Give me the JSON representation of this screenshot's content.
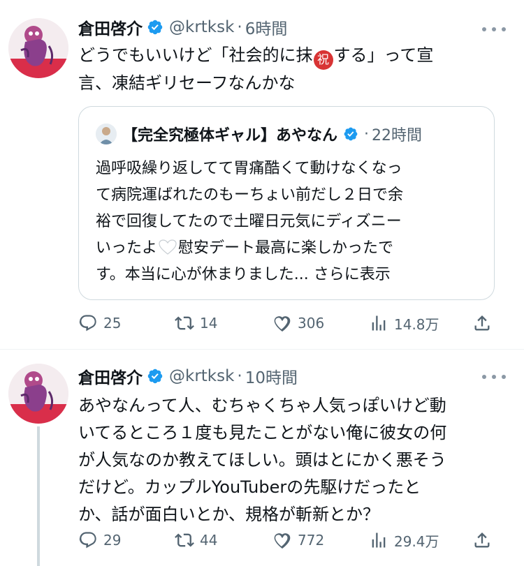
{
  "tweet1": {
    "author": {
      "name": "倉田啓介",
      "handle": "@krtksk",
      "time": "6時間"
    },
    "text_lines": [
      "どうでもいいけど「社会的に抹",
      "する」って宣",
      "言、凍結ギリセーフなんかな"
    ],
    "inline_emoji_char": "祝",
    "quote": {
      "author": {
        "name": "【完全究極体ギャル】あやなん",
        "time": "22時間"
      },
      "text_lines": [
        "過呼吸繰り返してて胃痛酷くて動けなくなっ",
        "て病院運ばれたのもーちょい前だし２日で余",
        "裕で回復してたので土曜日元気にディズニー",
        "いったよ",
        "慰安デート最高に楽しかったで",
        "す。本当に心が休まりました..."
      ],
      "show_more": "さらに表示"
    },
    "stats": {
      "replies": "25",
      "retweets": "14",
      "likes": "306",
      "views": "14.8万"
    }
  },
  "tweet2": {
    "author": {
      "name": "倉田啓介",
      "handle": "@krtksk",
      "time": "10時間"
    },
    "text_lines": [
      "あやなんって人、むちゃくちゃ人気っぽいけど動",
      "いてるところ１度も見たことがない俺に彼女の何",
      "が人気なのか教えてほしい。頭はとにかく悪そう",
      "だけど。カップルYouTuberの先駆けだったと",
      "か、話が面白いとか、規格が斬新とか？"
    ],
    "stats": {
      "replies": "29",
      "retweets": "44",
      "likes": "772",
      "views": "29.4万"
    }
  },
  "ui": {
    "separator": "·"
  },
  "colors": {
    "verified": "#1d9bf0",
    "secondary_text": "#536471",
    "border": "#cfd9de",
    "emoji_red": "#d83434"
  },
  "icons": [
    "verified-badge-icon",
    "more-options-icon",
    "reply-icon",
    "retweet-icon",
    "like-icon",
    "views-icon",
    "share-icon",
    "white-heart-emoji-icon"
  ]
}
